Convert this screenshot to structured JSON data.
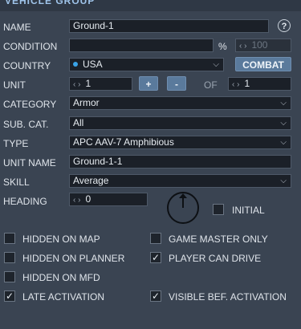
{
  "window": {
    "title": "VEHICLE GROUP"
  },
  "help_label": "?",
  "name": {
    "label": "NAME",
    "value": "Ground-1"
  },
  "condition": {
    "label": "CONDITION",
    "value": "",
    "percent": "%",
    "max_placeholder": "100"
  },
  "country": {
    "label": "COUNTRY",
    "value": "USA",
    "combat_label": "COMBAT",
    "dot_color": "#3aa3e8"
  },
  "unit": {
    "label": "UNIT",
    "value": "1",
    "plus": "+",
    "minus": "-",
    "of_label": "OF",
    "total": "1"
  },
  "category": {
    "label": "CATEGORY",
    "value": "Armor"
  },
  "subcat": {
    "label": "SUB. CAT.",
    "value": "All"
  },
  "type": {
    "label": "TYPE",
    "value": "APC AAV-7 Amphibious"
  },
  "unit_name": {
    "label": "UNIT NAME",
    "value": "Ground-1-1"
  },
  "skill": {
    "label": "SKILL",
    "value": "Average"
  },
  "heading": {
    "label": "HEADING",
    "value": "0",
    "initial_label": "INITIAL",
    "initial_checked": false
  },
  "spinner_arrows": "‹ ›",
  "checkboxes": [
    {
      "label": "HIDDEN ON MAP",
      "checked": false
    },
    {
      "label": "GAME MASTER ONLY",
      "checked": false
    },
    {
      "label": "HIDDEN ON PLANNER",
      "checked": false
    },
    {
      "label": "PLAYER CAN DRIVE",
      "checked": true
    },
    {
      "label": "HIDDEN ON MFD",
      "checked": false
    },
    {
      "label": "LATE ACTIVATION",
      "checked": true
    },
    {
      "label": "VISIBLE BEF. ACTIVATION",
      "checked": true
    }
  ],
  "icons": {
    "dropdown": "chevron-down-icon",
    "check": "check-icon",
    "compass": "heading-compass-icon"
  }
}
